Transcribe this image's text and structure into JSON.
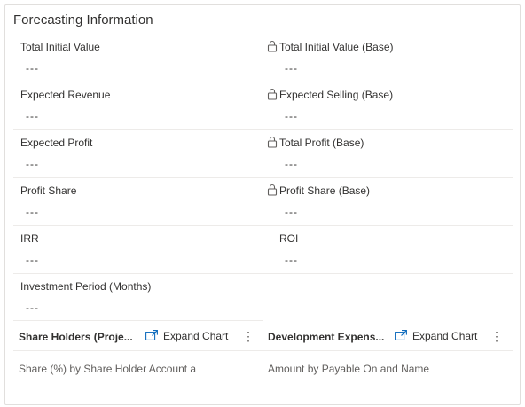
{
  "section": {
    "title": "Forecasting Information"
  },
  "fields": {
    "total_initial_value": {
      "label": "Total Initial Value",
      "value": "---"
    },
    "total_initial_value_base": {
      "label": "Total Initial Value (Base)",
      "value": "---"
    },
    "expected_revenue": {
      "label": "Expected Revenue",
      "value": "---"
    },
    "expected_selling_base": {
      "label": "Expected Selling (Base)",
      "value": "---"
    },
    "expected_profit": {
      "label": "Expected Profit",
      "value": "---"
    },
    "total_profit_base": {
      "label": "Total Profit (Base)",
      "value": "---"
    },
    "profit_share": {
      "label": "Profit Share",
      "value": "---"
    },
    "profit_share_base": {
      "label": "Profit Share (Base)",
      "value": "---"
    },
    "irr": {
      "label": "IRR",
      "value": "---"
    },
    "roi": {
      "label": "ROI",
      "value": "---"
    },
    "investment_period": {
      "label": "Investment Period (Months)",
      "value": "---"
    }
  },
  "charts": {
    "share_holders": {
      "title": "Share Holders (Proje...",
      "expand_label": "Expand Chart",
      "subtitle": "Share (%) by Share Holder Account a"
    },
    "development_expenses": {
      "title": "Development Expens...",
      "expand_label": "Expand Chart",
      "subtitle": "Amount by Payable On and Name"
    }
  },
  "icons": {
    "lock": "lock-icon",
    "expand": "expand-chart-icon",
    "more": "more-options-icon"
  }
}
